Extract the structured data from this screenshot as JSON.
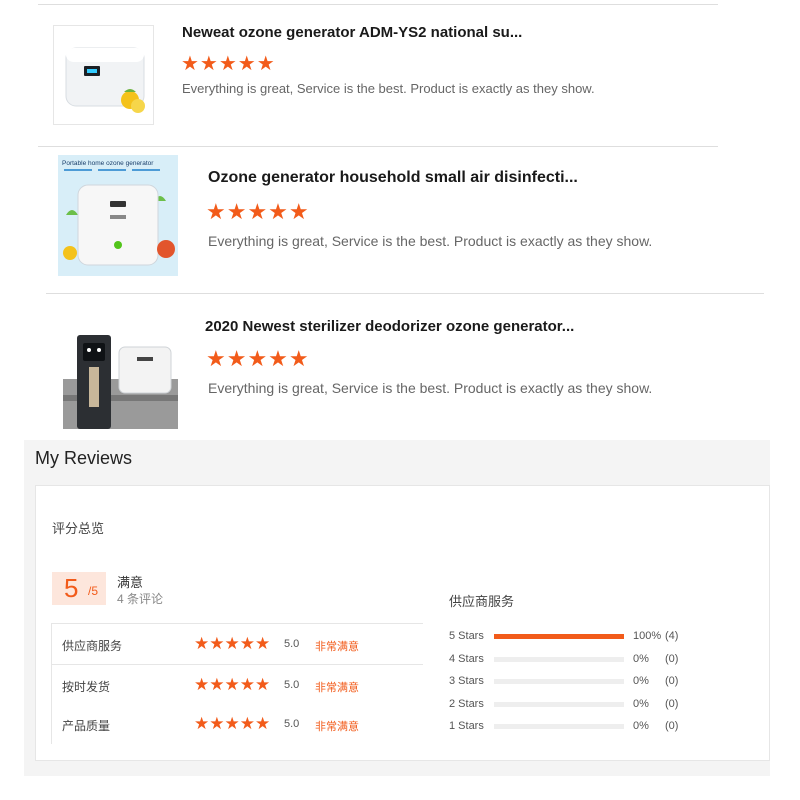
{
  "products": [
    {
      "title": "Neweat ozone generator ADM-YS2 national su...",
      "stars": "★★★★★",
      "rating": 5,
      "review": "Everything is great, Service is the best. Product is exactly as they show.",
      "image_caption": ""
    },
    {
      "title": "Ozone generator household small air disinfecti...",
      "stars": "★★★★★",
      "rating": 5,
      "review": "Everything is great, Service is the best. Product is exactly as they show.",
      "image_caption": "Portable home ozone generator"
    },
    {
      "title": "2020 Newest sterilizer deodorizer ozone generator...",
      "stars": "★★★★★",
      "rating": 5,
      "review": "Everything is great, Service is the best. Product is exactly as they show.",
      "image_caption": ""
    }
  ],
  "reviews": {
    "title": "My Reviews",
    "overview_label": "评分总览",
    "score": "5",
    "score_den": "/5",
    "score_word": "满意",
    "review_count": "4 条评论",
    "ratings": [
      {
        "label": "供应商服务",
        "stars": "★★★★★",
        "value": "5.0",
        "word": "非常满意"
      },
      {
        "label": "按时发货",
        "stars": "★★★★★",
        "value": "5.0",
        "word": "非常满意"
      },
      {
        "label": "产品质量",
        "stars": "★★★★★",
        "value": "5.0",
        "word": "非常满意"
      }
    ],
    "supplier_title": "供应商服务",
    "distribution": [
      {
        "label": "5 Stars",
        "percent": 100,
        "pct_text": "100%",
        "count": "(4)"
      },
      {
        "label": "4 Stars",
        "percent": 0,
        "pct_text": "0%",
        "count": "(0)"
      },
      {
        "label": "3 Stars",
        "percent": 0,
        "pct_text": "0%",
        "count": "(0)"
      },
      {
        "label": "2 Stars",
        "percent": 0,
        "pct_text": "0%",
        "count": "(0)"
      },
      {
        "label": "1 Stars",
        "percent": 0,
        "pct_text": "0%",
        "count": "(0)"
      }
    ]
  },
  "colors": {
    "accent": "#f25b1a",
    "bar_track": "#eeeeee",
    "panel_bg": "#f4f4f4"
  }
}
